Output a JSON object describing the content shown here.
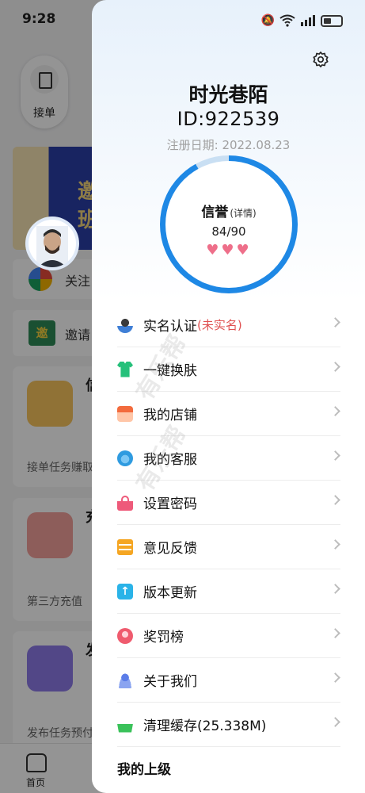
{
  "status_bar": {
    "time": "9:28"
  },
  "background_app": {
    "accept_label": "接单",
    "banner_text_1": "邀",
    "banner_text_2": "班",
    "follow_label": "关注",
    "invite_icon_text": "邀",
    "invite_label": "邀请",
    "card1_title": "信",
    "card1_footer": "接单任务赚取",
    "card2_title": "充",
    "card2_footer": "第三方充值",
    "card3_title": "发",
    "card3_footer": "发布任务预付",
    "tab_home": "首页"
  },
  "drawer": {
    "username": "时光巷陌",
    "user_id": "ID:922539",
    "register_date": "注册日期:  2022.08.23",
    "credit": {
      "label": "信誉",
      "detail": "(详情)",
      "score_text": "84/90",
      "hearts": "♥♥♥",
      "fraction": 0.92
    },
    "watermark": "有乐帮",
    "menu": [
      {
        "label": "实名认证",
        "note": "(未实名)",
        "icon": "id-card-icon"
      },
      {
        "label": "一键换肤",
        "icon": "tshirt-icon"
      },
      {
        "label": "我的店铺",
        "icon": "shop-icon"
      },
      {
        "label": "我的客服",
        "icon": "customer-service-icon"
      },
      {
        "label": "设置密码",
        "icon": "lock-icon"
      },
      {
        "label": "意见反馈",
        "icon": "feedback-icon"
      },
      {
        "label": "版本更新",
        "icon": "update-icon"
      },
      {
        "label": "奖罚榜",
        "icon": "trophy-icon"
      },
      {
        "label": "关于我们",
        "icon": "about-icon"
      },
      {
        "label": "清理缓存(25.338M)",
        "icon": "broom-icon"
      }
    ],
    "superior_heading": "我的上级"
  },
  "colors": {
    "accent": "#1e88e5",
    "warn": "#e05252",
    "heart": "#ee6f8a"
  }
}
